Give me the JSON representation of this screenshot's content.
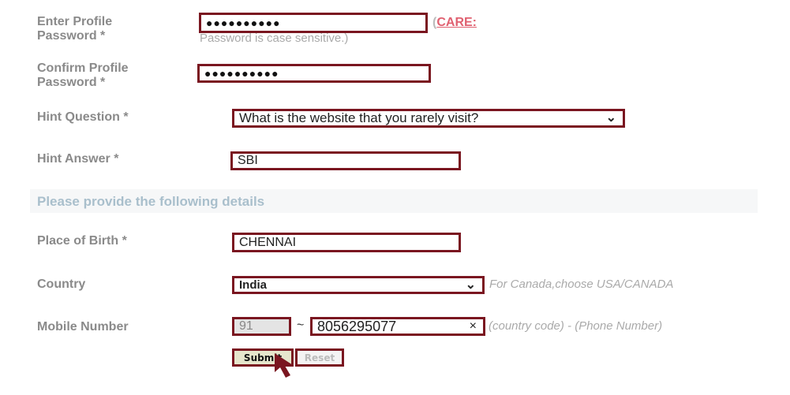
{
  "form": {
    "password": {
      "label_line1": "Enter Profile",
      "label_line2": "Password *",
      "value": "●●●●●●●●●●",
      "care_open": "(",
      "care_label": "CARE:",
      "care_note": "Password is case sensitive.)"
    },
    "confirm_password": {
      "label_line1": "Confirm Profile",
      "label_line2": "Password *",
      "value": "●●●●●●●●●●"
    },
    "hint_question": {
      "label": "Hint Question *",
      "value": "What is the website that you rarely visit?"
    },
    "hint_answer": {
      "label": "Hint Answer *",
      "value": "SBI"
    },
    "section_title": "Please provide the following details",
    "place_of_birth": {
      "label": "Place of Birth *",
      "value": "CHENNAI"
    },
    "country": {
      "label": "Country",
      "value": "India",
      "note": "For Canada,choose USA/CANADA"
    },
    "mobile": {
      "label": "Mobile Number",
      "country_code": "91",
      "separator": "~",
      "number": "8056295077",
      "clear": "×",
      "note": "(country code) - (Phone Number)"
    },
    "submit_label": "Submit",
    "reset_label": "Reset"
  },
  "colors": {
    "accent": "#7a1620",
    "care": "#e06070"
  }
}
